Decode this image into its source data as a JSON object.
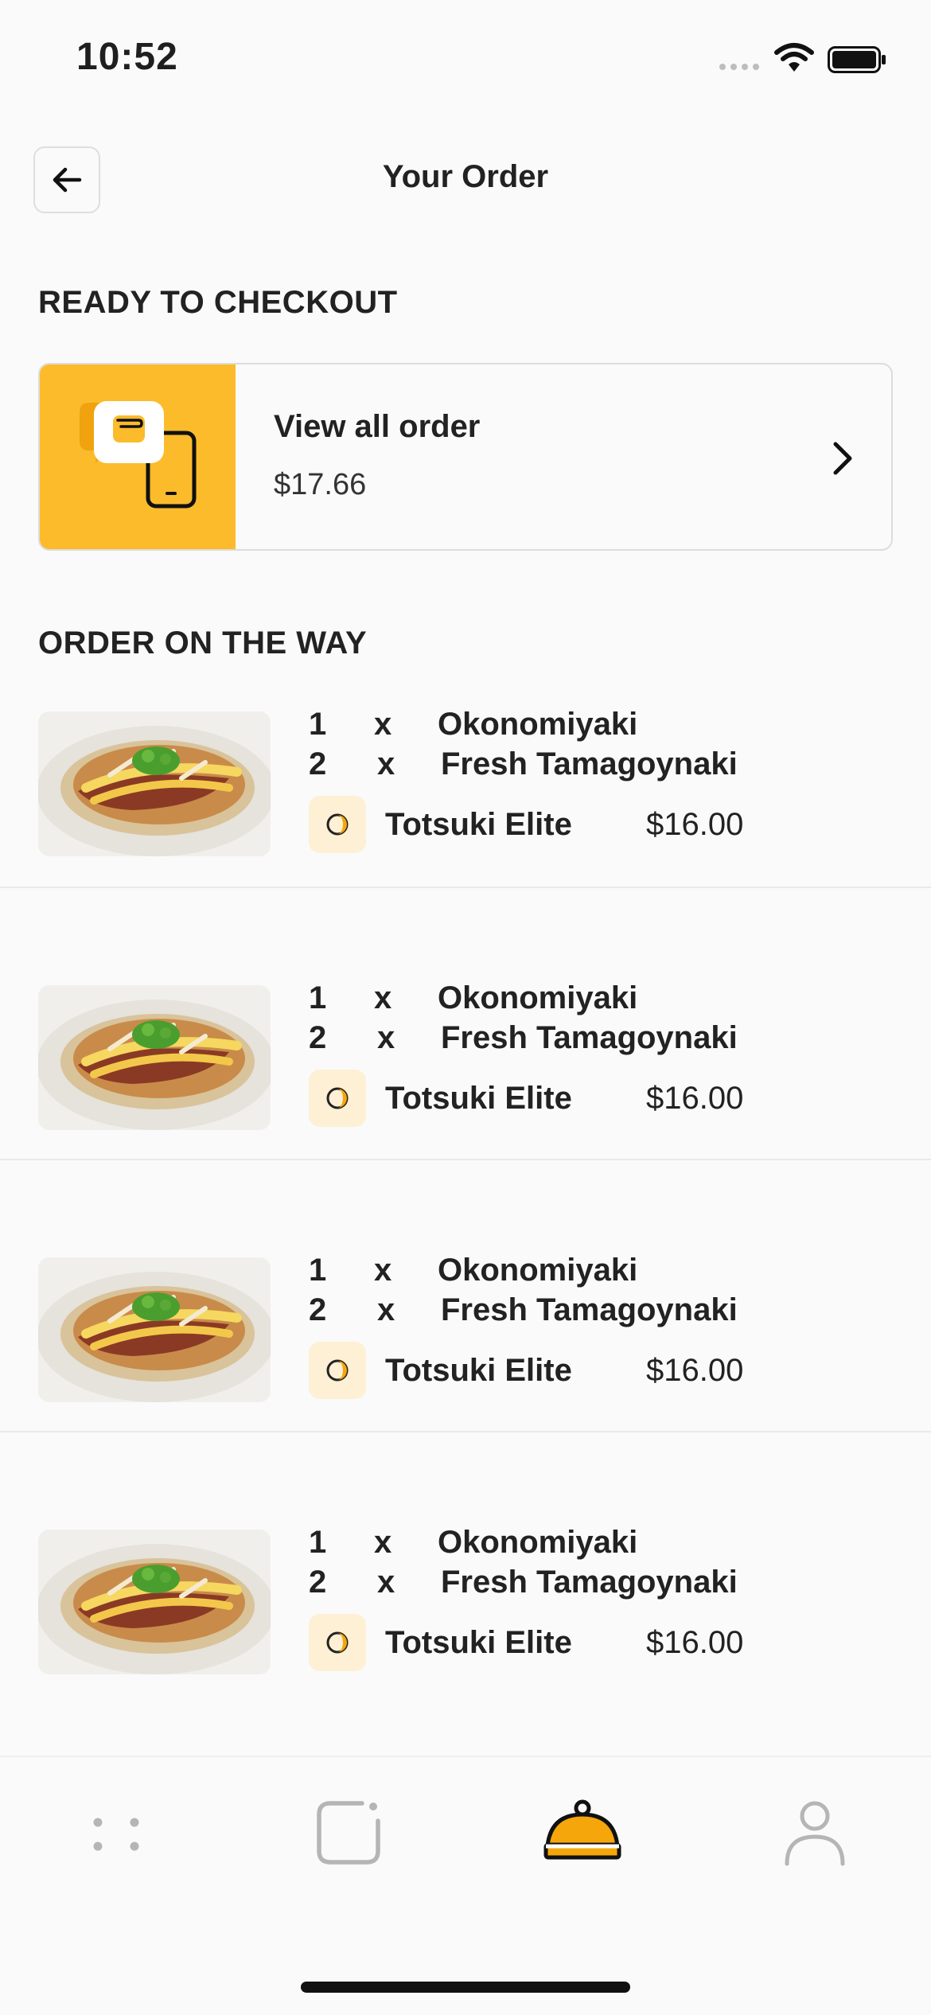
{
  "status_bar": {
    "time": "10:52"
  },
  "header": {
    "title": "Your Order"
  },
  "sections": {
    "ready": "READY TO CHECKOUT",
    "on_the_way": "ORDER ON THE WAY"
  },
  "checkout": {
    "title": "View all order",
    "price": "$17.66"
  },
  "orders": [
    {
      "lines": [
        {
          "qty": "1",
          "x": "x",
          "name": "Okonomiyaki"
        },
        {
          "qty": "2",
          "x": "x",
          "name": "Fresh Tamagoynaki"
        }
      ],
      "restaurant": "Totsuki Elite",
      "price": "$16.00"
    },
    {
      "lines": [
        {
          "qty": "1",
          "x": "x",
          "name": "Okonomiyaki"
        },
        {
          "qty": "2",
          "x": "x",
          "name": "Fresh Tamagoynaki"
        }
      ],
      "restaurant": "Totsuki Elite",
      "price": "$16.00"
    },
    {
      "lines": [
        {
          "qty": "1",
          "x": "x",
          "name": "Okonomiyaki"
        },
        {
          "qty": "2",
          "x": "x",
          "name": "Fresh Tamagoynaki"
        }
      ],
      "restaurant": "Totsuki Elite",
      "price": "$16.00"
    },
    {
      "lines": [
        {
          "qty": "1",
          "x": "x",
          "name": "Okonomiyaki"
        },
        {
          "qty": "2",
          "x": "x",
          "name": "Fresh Tamagoynaki"
        }
      ],
      "restaurant": "Totsuki Elite",
      "price": "$16.00"
    }
  ],
  "nav": {
    "icons": [
      "grid-icon",
      "chat-icon",
      "food-cover-icon",
      "profile-icon"
    ],
    "active": "food-cover-icon"
  },
  "colors": {
    "accent": "#fcbb2b",
    "active_nav": "#f5a60a",
    "badge_bg": "#fdf0d4"
  }
}
